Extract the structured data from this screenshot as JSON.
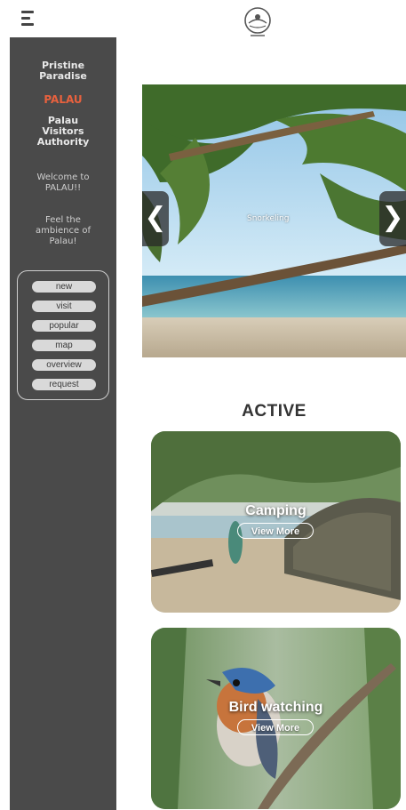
{
  "header": {
    "menu_icon": "hamburger-menu-icon",
    "logo_icon": "palau-logo-icon"
  },
  "sidebar": {
    "title": "Pristine Paradise",
    "highlight": "PALAU",
    "authority": "Palau Visitors Authority",
    "welcome": "Welcome to PALAU!!",
    "tagline": "Feel the ambience of Palau!",
    "links": [
      "new",
      "visit",
      "popular",
      "map",
      "overview",
      "request"
    ]
  },
  "hero": {
    "caption": "Snorkeling",
    "prev_icon": "chevron-left-icon",
    "next_icon": "chevron-right-icon",
    "prev_glyph": "❮",
    "next_glyph": "❯"
  },
  "section": {
    "title": "ACTIVE"
  },
  "activities": [
    {
      "title": "Camping",
      "button": "View More"
    },
    {
      "title": "Bird watching",
      "button": "View More"
    }
  ],
  "colors": {
    "sidebar_bg": "#4a4a4a",
    "accent": "#e8613e"
  }
}
